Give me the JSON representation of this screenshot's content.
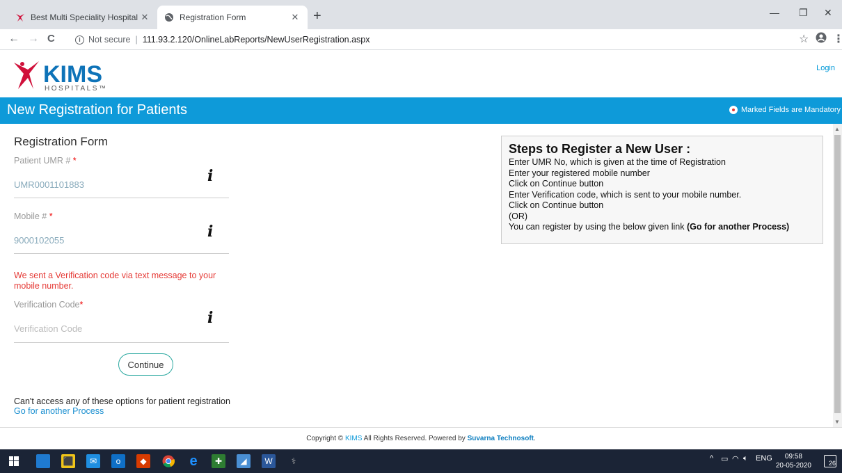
{
  "browser": {
    "tabs": [
      {
        "label": "Best Multi Speciality Hospital in S",
        "active": false
      },
      {
        "label": "Registration Form",
        "active": true
      }
    ],
    "new_tab": "+",
    "window_controls": {
      "minimize": "—",
      "restore": "❐",
      "close": "✕"
    },
    "nav": {
      "back": "←",
      "forward": "→",
      "reload": "C"
    },
    "address": {
      "security": "Not secure",
      "separator": "|",
      "url": "111.93.2.120/OnlineLabReports/NewUserRegistration.aspx"
    },
    "icons": {
      "star": "star-icon",
      "profile": "account-icon",
      "menu": "kebab-menu-icon"
    }
  },
  "header": {
    "logo_text": "KIMS",
    "logo_sub": "HOSPITALS™",
    "login_label": "Login"
  },
  "banner": {
    "title": "New Registration for Patients",
    "mandatory_note": "Marked Fields are Mandatory"
  },
  "form": {
    "title": "Registration Form",
    "fields": [
      {
        "label": "Patient UMR #",
        "required_mark": "*",
        "value": "UMR0001101883"
      },
      {
        "label": "Mobile #",
        "required_mark": "*",
        "value": "9000102055"
      },
      {
        "label": "Verification Code",
        "required_mark": "*",
        "value": "",
        "placeholder": "Verification Code"
      }
    ],
    "info_glyph": "i",
    "alert": "We sent a Verification code via text message to your mobile number.",
    "continue_label": "Continue",
    "access_text": "Can't access any of these options for patient registration",
    "access_link": "Go for another Process"
  },
  "steps": {
    "title": "Steps to Register a New User :",
    "lines": [
      "Enter UMR No, which is given at the time of Registration",
      "Enter your registered mobile number",
      "Click on Continue button",
      "Enter Verification code, which is sent to your mobile number.",
      "Click on Continue button",
      "(OR)"
    ],
    "last_line_prefix": "You can register by using the below given link ",
    "last_line_bold": "(Go for another Process)"
  },
  "footer": {
    "prefix": "Copyright © ",
    "brand": "KIMS",
    "middle": " All Rights Reserved.   Powered by ",
    "vendor": "Suvarna Technosoft",
    "suffix": "."
  },
  "taskbar": {
    "tray": {
      "chevron": "^",
      "lang": "ENG",
      "time": "09:58",
      "date": "20-05-2020",
      "notifications": "26"
    }
  },
  "colors": {
    "accent": "#0e9ad9",
    "alert": "#e53935",
    "brand_red": "#c8102e"
  }
}
